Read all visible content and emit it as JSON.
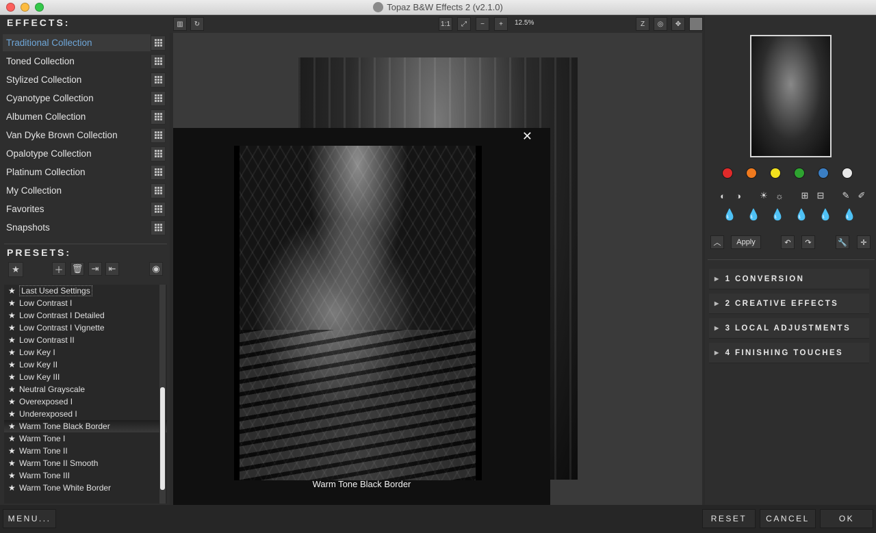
{
  "window": {
    "title": "Topaz B&W Effects 2 (v2.1.0)"
  },
  "effects": {
    "heading": "EFFECTS:",
    "collections": [
      "Traditional Collection",
      "Toned Collection",
      "Stylized Collection",
      "Cyanotype Collection",
      "Albumen Collection",
      "Van Dyke Brown Collection",
      "Opalotype Collection",
      "Platinum Collection",
      "My Collection",
      "Favorites",
      "Snapshots"
    ],
    "active_index": 0
  },
  "presets": {
    "heading": "PRESETS:",
    "items": [
      "Last Used Settings",
      "Low Contrast I",
      "Low Contrast I Detailed",
      "Low Contrast I Vignette",
      "Low Contrast II",
      "Low Key I",
      "Low Key II",
      "Low Key III",
      "Neutral Grayscale",
      "Overexposed I",
      "Underexposed I",
      "Warm Tone Black Border",
      "Warm Tone I",
      "Warm Tone II",
      "Warm Tone II Smooth",
      "Warm Tone III",
      "Warm Tone White Border"
    ],
    "selected_index": 11
  },
  "toolbar": {
    "one_to_one": "1:1",
    "zoom_level": "12.5%"
  },
  "preview_popup": {
    "caption": "Warm Tone Black Border",
    "close_glyph": "✕"
  },
  "color_dots": [
    "#e02a2a",
    "#f07a1e",
    "#f2e21e",
    "#2ea330",
    "#3b7fc4",
    "#e8e8e8"
  ],
  "right_panel": {
    "apply_label": "Apply",
    "sections": [
      "1 CONVERSION",
      "2 CREATIVE EFFECTS",
      "3 LOCAL ADJUSTMENTS",
      "4 FINISHING TOUCHES"
    ]
  },
  "bottom": {
    "menu_label": "MENU...",
    "reset_label": "RESET",
    "cancel_label": "CANCEL",
    "ok_label": "OK"
  }
}
